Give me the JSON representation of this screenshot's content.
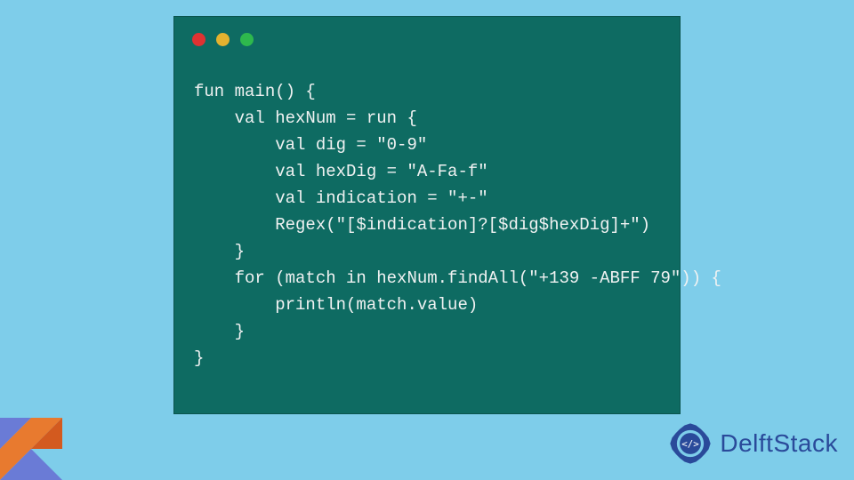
{
  "code": {
    "lines": [
      "fun main() {",
      "    val hexNum = run {",
      "        val dig = \"0-9\"",
      "        val hexDig = \"A-Fa-f\"",
      "        val indication = \"+-\"",
      "        Regex(\"[$indication]?[$dig$hexDig]+\")",
      "    }",
      "    for (match in hexNum.findAll(\"+139 -ABFF 79\")) {",
      "        println(match.value)",
      "    }",
      "}"
    ]
  },
  "brand": {
    "name": "DelftStack"
  },
  "window_controls": {
    "red": "close",
    "yellow": "minimize",
    "green": "maximize"
  }
}
